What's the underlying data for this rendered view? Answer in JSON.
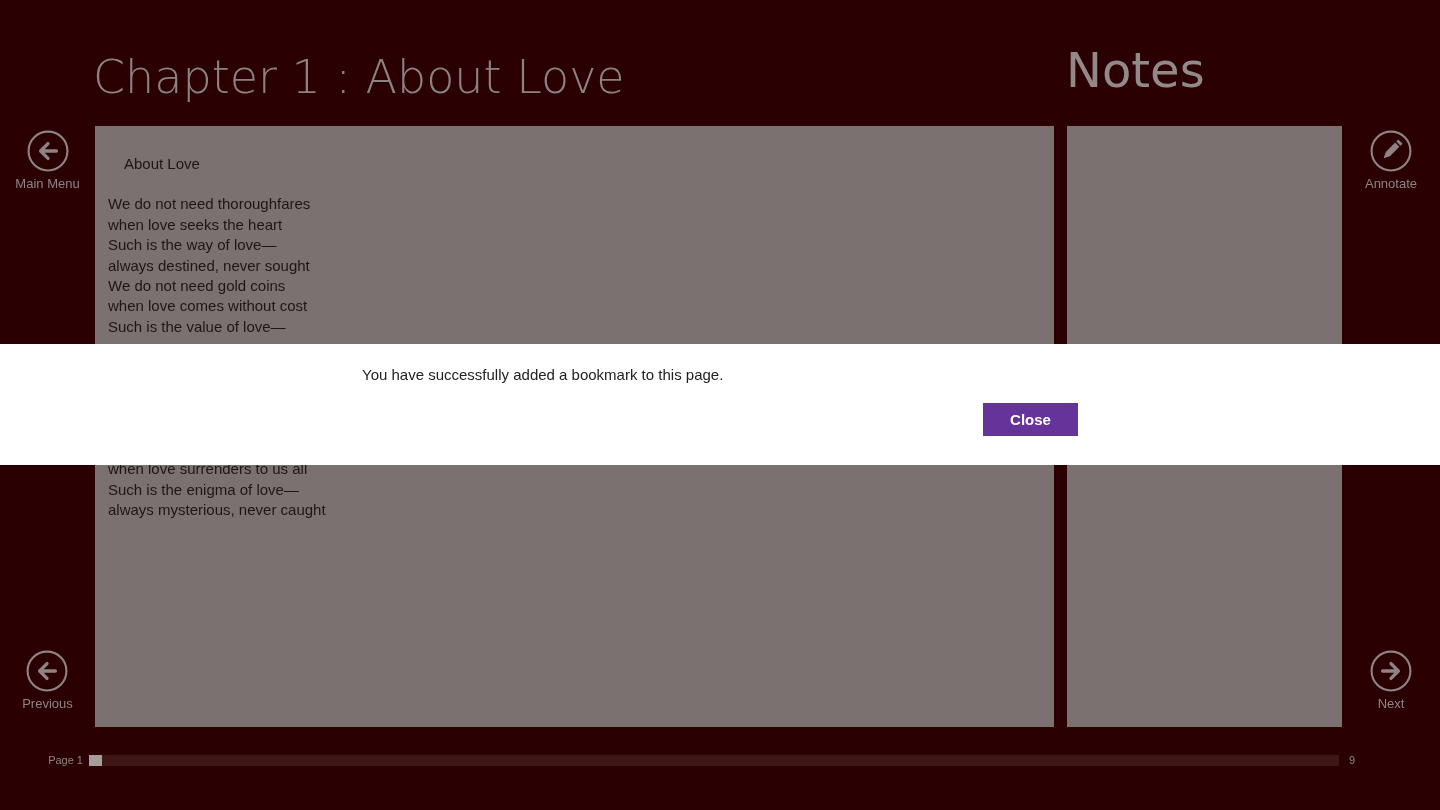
{
  "chapter_title": "Chapter 1 : About Love",
  "notes": {
    "title": "Notes"
  },
  "page": {
    "heading": "About Love",
    "lines_above": [
      "We do not need thoroughfares",
      "when love seeks the heart",
      "Such is the way of love—",
      "always destined, never sought",
      "We do not need gold coins",
      "when love comes without cost",
      "Such is the value of love—"
    ],
    "lines_below": [
      "when love surrenders to us all",
      "Such is the enigma of love—",
      "always mysterious, never caught"
    ]
  },
  "left_buttons": [
    {
      "label": "Main Menu",
      "kind": "back"
    },
    {
      "label": "Previous",
      "kind": "back"
    }
  ],
  "right_buttons": [
    {
      "label": "Annotate",
      "kind": "pencil"
    },
    {
      "label": "Next",
      "kind": "forward"
    }
  ],
  "progress": {
    "start_label": "Page 1",
    "end_label": "9",
    "level": 0.01
  },
  "dialog": {
    "message": "You have successfully added a bookmark to this page.",
    "button": "Close"
  }
}
